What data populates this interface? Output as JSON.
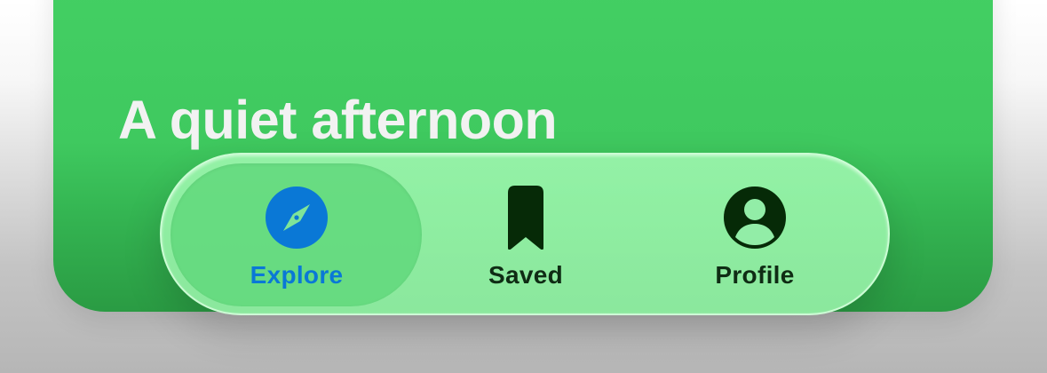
{
  "card": {
    "title": "A quiet afternoon"
  },
  "tabbar": {
    "selected": "Explore",
    "tabs": [
      {
        "label": "Explore",
        "icon": "compass-icon",
        "selected": true,
        "color": "#0a78d6"
      },
      {
        "label": "Saved",
        "icon": "bookmark-icon",
        "selected": false,
        "color": "#0f2c14"
      },
      {
        "label": "Profile",
        "icon": "person-circle-icon",
        "selected": false,
        "color": "#0f2c14"
      }
    ]
  },
  "colors": {
    "card_green": "#3fc95f",
    "tabbar_green": "#96f3a8",
    "selected_pill": "#60d87b",
    "accent_blue": "#0a78d6",
    "icon_dark": "#062a07"
  }
}
